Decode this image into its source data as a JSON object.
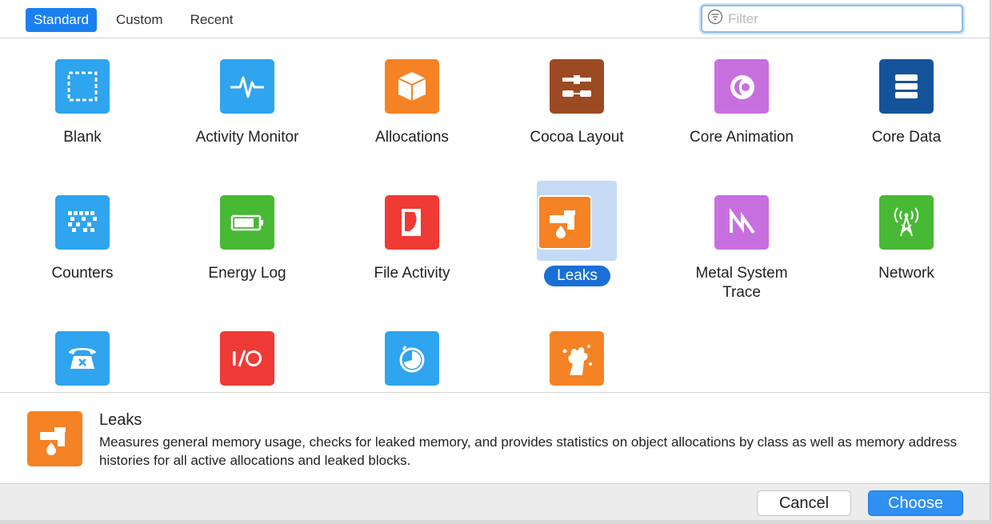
{
  "tabs": [
    {
      "label": "Standard",
      "active": true
    },
    {
      "label": "Custom",
      "active": false
    },
    {
      "label": "Recent",
      "active": false
    }
  ],
  "filter": {
    "placeholder": "Filter",
    "value": ""
  },
  "templates": [
    {
      "label": "Blank",
      "icon": "blank-template-icon",
      "color": "#2fa4ef"
    },
    {
      "label": "Activity Monitor",
      "icon": "activity-monitor-icon",
      "color": "#2fa4ef"
    },
    {
      "label": "Allocations",
      "icon": "allocations-icon",
      "color": "#f58224"
    },
    {
      "label": "Cocoa Layout",
      "icon": "cocoa-layout-icon",
      "color": "#9c4a22"
    },
    {
      "label": "Core Animation",
      "icon": "core-animation-icon",
      "color": "#c86fe0"
    },
    {
      "label": "Core Data",
      "icon": "core-data-icon",
      "color": "#14539a"
    },
    {
      "label": "Counters",
      "icon": "counters-icon",
      "color": "#2fa4ef"
    },
    {
      "label": "Energy Log",
      "icon": "energy-log-icon",
      "color": "#48b934"
    },
    {
      "label": "File Activity",
      "icon": "file-activity-icon",
      "color": "#ef3a35"
    },
    {
      "label": "Leaks",
      "icon": "leaks-icon",
      "color": "#f58224",
      "selected": true
    },
    {
      "label": "Metal System\nTrace",
      "icon": "metal-system-trace-icon",
      "color": "#c86fe0"
    },
    {
      "label": "Network",
      "icon": "network-icon",
      "color": "#48b934"
    },
    {
      "label": "",
      "icon": "telephone-icon",
      "color": "#2fa4ef"
    },
    {
      "label": "",
      "icon": "io-icon",
      "color": "#ef3a35"
    },
    {
      "label": "",
      "icon": "timer-icon",
      "color": "#2fa4ef"
    },
    {
      "label": "",
      "icon": "splash-icon",
      "color": "#f58224"
    }
  ],
  "detail": {
    "title": "Leaks",
    "description": "Measures general memory usage, checks for leaked memory, and provides statistics on object allocations by class as well as memory address histories for all active allocations and leaked blocks."
  },
  "footer": {
    "cancel_label": "Cancel",
    "choose_label": "Choose"
  }
}
